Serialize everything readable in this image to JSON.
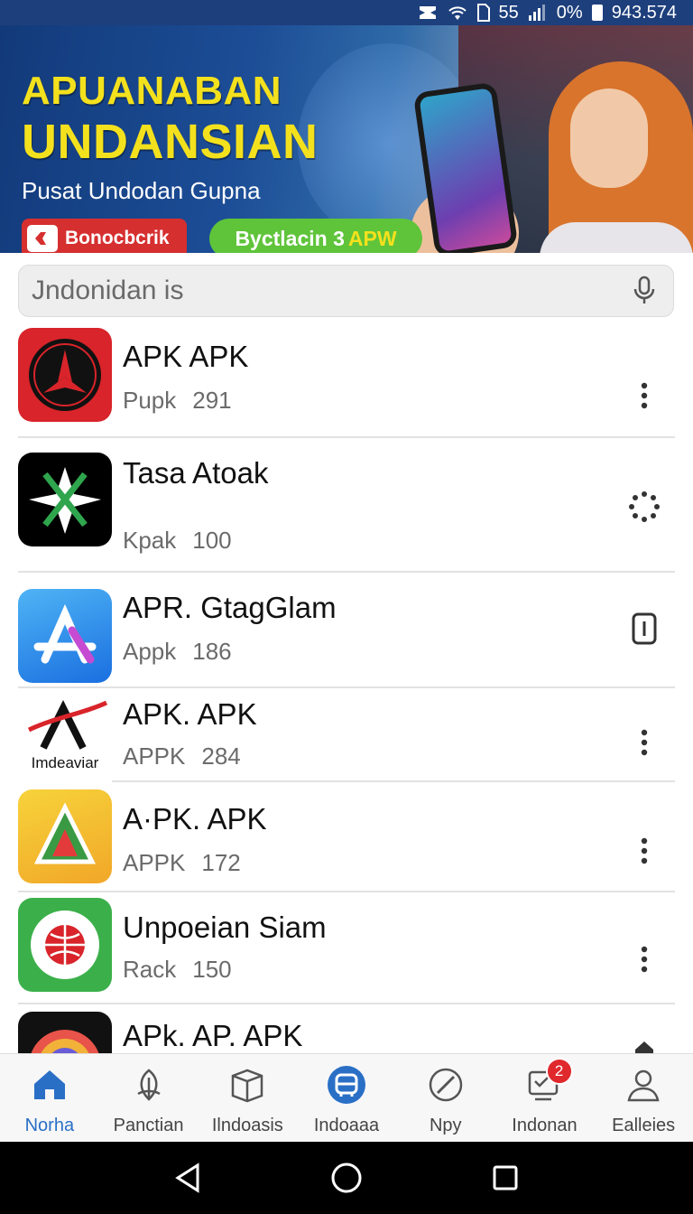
{
  "status_bar": {
    "signal_text": "55",
    "battery_percent": "0%",
    "time": "943.574"
  },
  "banner": {
    "title_line1": "APUANABAN",
    "title_line2": "UNDANSIAN",
    "subtitle": "Pusat Undodan Gupna",
    "badge_red_label": "Bonocbcrik",
    "badge_green_label": "Byctlacin 3",
    "badge_green_accent": "APW"
  },
  "search": {
    "placeholder": "Jndonidan is"
  },
  "apps": [
    {
      "name": "APK APK",
      "meta_label": "Pupk",
      "meta_value": "291",
      "action": "more-vertical"
    },
    {
      "name": "Tasa Atoak",
      "meta_label": "Kpak",
      "meta_value": "100",
      "action": "loading-spinner"
    },
    {
      "name": "APR. GtagGlam",
      "meta_label": "Appk",
      "meta_value": "186",
      "action": "open"
    },
    {
      "name": "APK. APK",
      "meta_label": "APPK",
      "meta_value": "284",
      "action": "more-vertical",
      "icon_caption": "Imdeaviar"
    },
    {
      "name": "A·PK. APK",
      "meta_label": "APPK",
      "meta_value": "172",
      "action": "more-vertical"
    },
    {
      "name": "Unpoeian Siam",
      "meta_label": "Rack",
      "meta_value": "150",
      "action": "more-vertical"
    },
    {
      "name": "APk. AP. APK",
      "meta_label": "",
      "meta_value": "",
      "action": "home"
    }
  ],
  "bottom_nav": [
    {
      "label": "Norha",
      "icon": "home-icon",
      "active": true
    },
    {
      "label": "Panctian",
      "icon": "leaf-icon"
    },
    {
      "label": "Ilndoasis",
      "icon": "box-icon"
    },
    {
      "label": "Indoaaa",
      "icon": "bus-icon"
    },
    {
      "label": "Npy",
      "icon": "compass-icon"
    },
    {
      "label": "Indonan",
      "icon": "inbox-icon",
      "badge": "2"
    },
    {
      "label": "Ealleies",
      "icon": "user-icon"
    }
  ],
  "colors": {
    "accent": "#2a6fc6",
    "banner_title": "#f4e11d",
    "badge_red": "#d62f2f",
    "badge_green": "#5fc43a"
  }
}
